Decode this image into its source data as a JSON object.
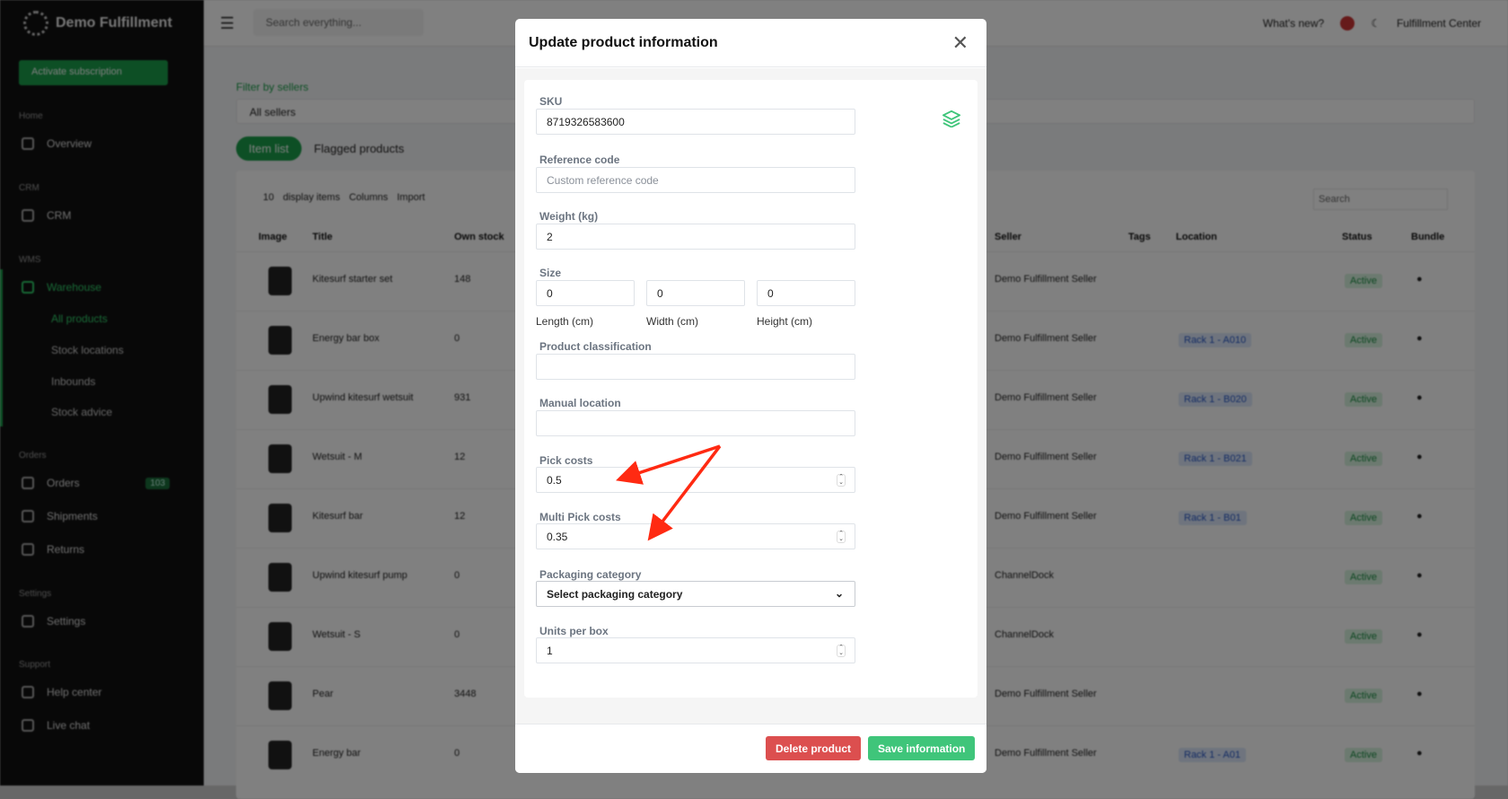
{
  "sidebar": {
    "brand": "Demo Fulfillment",
    "activate": "Activate subscription",
    "sections": [
      "Home",
      "CRM",
      "WMS",
      "Orders",
      "Settings",
      "Support"
    ],
    "items": {
      "overview": "Overview",
      "crm": "CRM",
      "warehouse": "Warehouse",
      "orders": "Orders",
      "orders_badge": "103",
      "shipments": "Shipments",
      "returns": "Returns",
      "settings": "Settings",
      "help": "Help center",
      "chat": "Live chat"
    },
    "warehouse_sub": [
      "All products",
      "Stock locations",
      "Inbounds",
      "Stock advice"
    ]
  },
  "topbar": {
    "search_placeholder": "Search everything...",
    "whats_new": "What's new?",
    "account": "Fulfillment Center"
  },
  "main": {
    "filter_label": "Filter by sellers",
    "sellers": "All sellers",
    "tabs": [
      "Item list",
      "Flagged products"
    ],
    "per_page": "10",
    "display_items": "display items",
    "columns": "Columns",
    "import": "Import",
    "search_placeholder": "Search",
    "headers": [
      "Image",
      "Title",
      "Own stock",
      "Seller",
      "Tags",
      "Location",
      "Status",
      "Bundle"
    ],
    "rows": [
      {
        "title": "Kitesurf starter set",
        "stock": "148",
        "seller": "Demo Fulfillment Seller",
        "location": "",
        "status": "Active"
      },
      {
        "title": "Energy bar box",
        "stock": "0",
        "seller": "Demo Fulfillment Seller",
        "location": "Rack 1 - A010",
        "status": "Active"
      },
      {
        "title": "Upwind kitesurf wetsuit",
        "stock": "931",
        "seller": "Demo Fulfillment Seller",
        "location": "Rack 1 - B020",
        "status": "Active"
      },
      {
        "title": "Wetsuit - M",
        "stock": "12",
        "seller": "Demo Fulfillment Seller",
        "location": "Rack 1 - B021",
        "status": "Active"
      },
      {
        "title": "Kitesurf bar",
        "stock": "12",
        "seller": "Demo Fulfillment Seller",
        "location": "Rack 1 - B01",
        "status": "Active"
      },
      {
        "title": "Upwind kitesurf pump",
        "stock": "0",
        "seller": "ChannelDock",
        "location": "",
        "status": "Active"
      },
      {
        "title": "Wetsuit - S",
        "stock": "0",
        "seller": "ChannelDock",
        "location": "",
        "status": "Active"
      },
      {
        "title": "Pear",
        "stock": "3448",
        "seller": "Demo Fulfillment Seller",
        "location": "",
        "status": "Active"
      },
      {
        "title": "Energy bar",
        "stock": "0",
        "seller": "Demo Fulfillment Seller",
        "location": "Rack 1 - A01",
        "status": "Active"
      }
    ]
  },
  "modal": {
    "title": "Update product information",
    "sku": {
      "label": "SKU",
      "value": "8719326583600"
    },
    "reference": {
      "label": "Reference code",
      "placeholder": "Custom reference code"
    },
    "weight": {
      "label": "Weight (kg)",
      "value": "2"
    },
    "size": {
      "label": "Size",
      "length": "0",
      "width": "0",
      "height": "0",
      "length_label": "Length (cm)",
      "width_label": "Width (cm)",
      "height_label": "Height (cm)"
    },
    "classification": {
      "label": "Product classification",
      "value": ""
    },
    "manual_location": {
      "label": "Manual location",
      "value": ""
    },
    "pick_costs": {
      "label": "Pick costs",
      "value": "0.5"
    },
    "multi_pick_costs": {
      "label": "Multi Pick costs",
      "value": "0.35"
    },
    "packaging": {
      "label": "Packaging category",
      "value": "Select packaging category"
    },
    "units_per_box": {
      "label": "Units per box",
      "value": "1"
    },
    "delete": "Delete product",
    "save": "Save information"
  },
  "colors": {
    "accent": "#3fc57a",
    "danger": "#dc4f4f",
    "annotation": "#ff2a12"
  }
}
